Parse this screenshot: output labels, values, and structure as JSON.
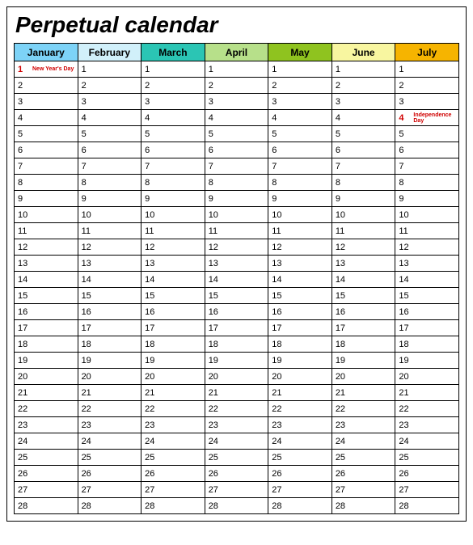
{
  "title": "Perpetual calendar",
  "months": [
    {
      "name": "January",
      "color": "#7dd3f7"
    },
    {
      "name": "February",
      "color": "#d1f0fa"
    },
    {
      "name": "March",
      "color": "#2bc5b4"
    },
    {
      "name": "April",
      "color": "#b7e08a"
    },
    {
      "name": "May",
      "color": "#8fc31f"
    },
    {
      "name": "June",
      "color": "#f8f6a0"
    },
    {
      "name": "July",
      "color": "#f6b400"
    }
  ],
  "days": [
    1,
    2,
    3,
    4,
    5,
    6,
    7,
    8,
    9,
    10,
    11,
    12,
    13,
    14,
    15,
    16,
    17,
    18,
    19,
    20,
    21,
    22,
    23,
    24,
    25,
    26,
    27,
    28
  ],
  "holidays": [
    {
      "month": "January",
      "day": 1,
      "label": "New Year's Day"
    },
    {
      "month": "July",
      "day": 4,
      "label": "Independence Day"
    }
  ]
}
